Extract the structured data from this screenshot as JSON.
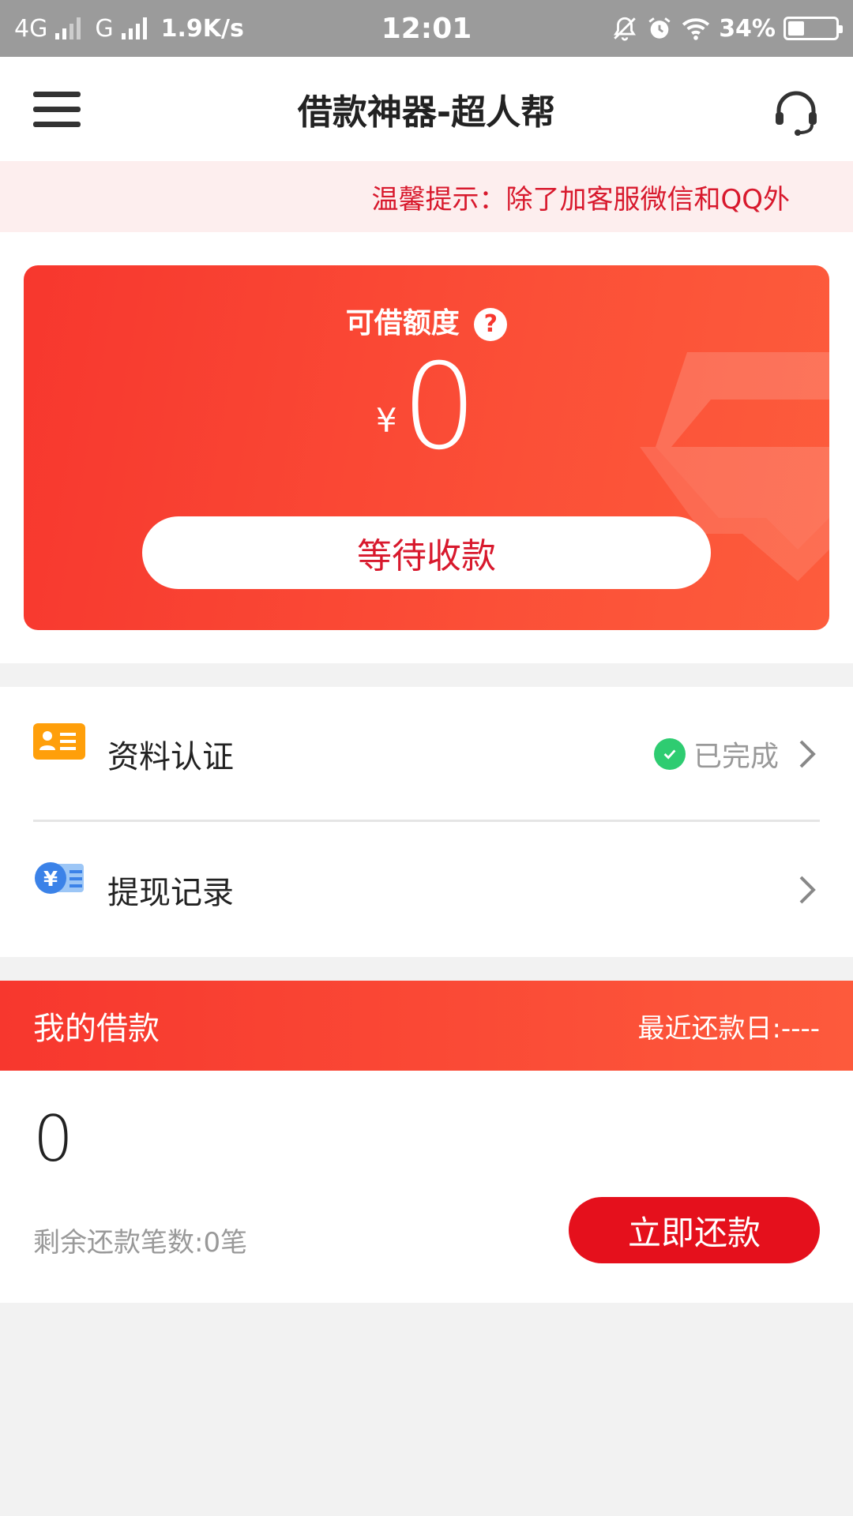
{
  "status_bar": {
    "network_1": "4G",
    "network_2": "G",
    "speed": "1.9K/s",
    "time": "12:01",
    "battery": "34%",
    "battery_level": 0.34
  },
  "nav": {
    "title": "借款神器-超人帮"
  },
  "notice": {
    "text": "温馨提示：除了加客服微信和QQ外"
  },
  "credit": {
    "label": "可借额度",
    "help": "?",
    "currency": "¥",
    "amount": "0",
    "button": "等待收款"
  },
  "menu": {
    "items": [
      {
        "label": "资料认证",
        "status": "已完成"
      },
      {
        "label": "提现记录",
        "status": ""
      }
    ]
  },
  "loan": {
    "title": "我的借款",
    "recent_date": "最近还款日:----",
    "amount": "0",
    "remaining": "剩余还款笔数:0笔",
    "repay_button": "立即还款"
  },
  "colors": {
    "accent": "#f7372e",
    "button_red": "#e5101c",
    "notice_text": "#d8192d",
    "success": "#2ecc71"
  }
}
